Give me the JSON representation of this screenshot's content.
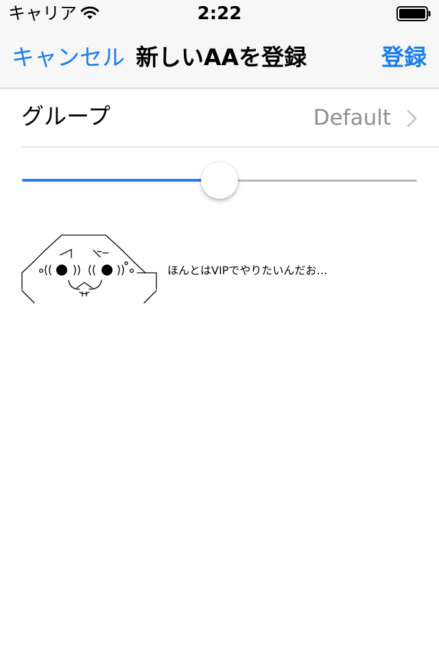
{
  "status_bar": {
    "carrier": "キャリア",
    "time": "2:22",
    "wifi_icon": "wifi-icon",
    "battery_icon": "battery-icon"
  },
  "nav": {
    "cancel_label": "キャンセル",
    "title": "新しいAAを登録",
    "register_label": "登録"
  },
  "group_row": {
    "label": "グループ",
    "value": "Default",
    "chevron_icon": "chevron-right-icon"
  },
  "size_slider": {
    "value": 0.5
  },
  "aa_preview": {
    "caption": "ほんとはVIPでやりたいんだお…"
  },
  "colors": {
    "accent": "#1a7cf0",
    "secondary_text": "#8e8e93",
    "nav_background": "#f7f7f8",
    "separator": "#c8c7cc",
    "track_max": "#b6b6b6"
  }
}
